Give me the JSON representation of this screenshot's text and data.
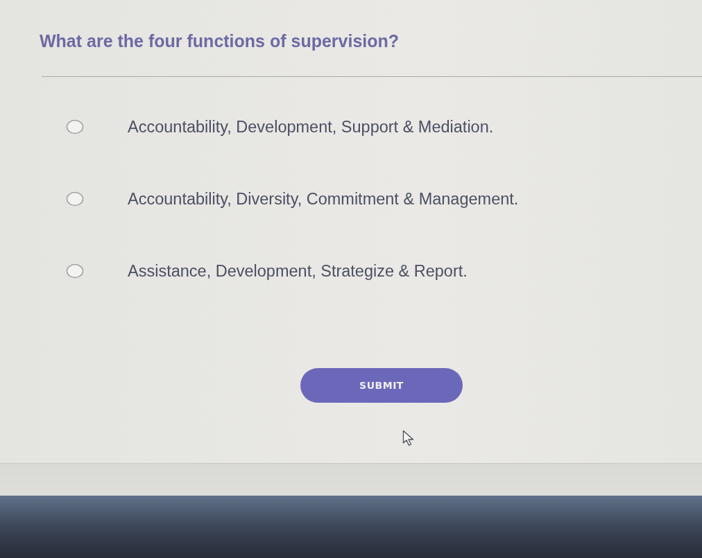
{
  "question": {
    "title": "What are the four functions of supervision?"
  },
  "options": [
    {
      "label": "Accountability, Development, Support & Mediation.",
      "selected": false
    },
    {
      "label": "Accountability, Diversity, Commitment & Management.",
      "selected": false
    },
    {
      "label": "Assistance, Development, Strategize & Report.",
      "selected": false
    }
  ],
  "submit_button": {
    "label": "SUBMIT"
  }
}
